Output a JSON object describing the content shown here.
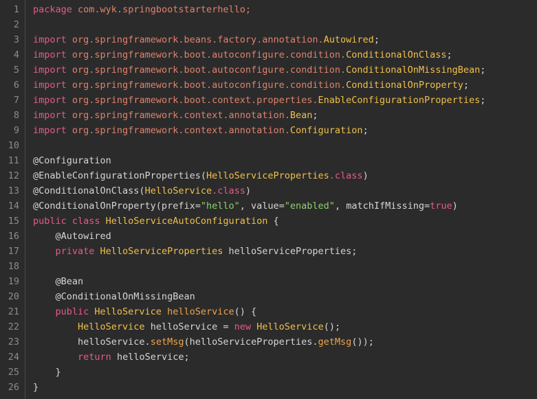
{
  "editor": {
    "lines": [
      [
        {
          "t": "package",
          "c": "kw"
        },
        {
          "t": " com.",
          "c": "pk"
        },
        {
          "t": "wyk.",
          "c": "pk"
        },
        {
          "t": "springbootstarterhello;",
          "c": "pk"
        }
      ],
      [],
      [
        {
          "t": "import",
          "c": "kw"
        },
        {
          "t": " org.springframework.beans.factory.annotation.",
          "c": "pk"
        },
        {
          "t": "Autowired",
          "c": "ty"
        },
        {
          "t": ";",
          "c": "pl"
        }
      ],
      [
        {
          "t": "import",
          "c": "kw"
        },
        {
          "t": " org.springframework.boot.autoconfigure.condition.",
          "c": "pk"
        },
        {
          "t": "ConditionalOnClass",
          "c": "ty"
        },
        {
          "t": ";",
          "c": "pl"
        }
      ],
      [
        {
          "t": "import",
          "c": "kw"
        },
        {
          "t": " org.springframework.boot.autoconfigure.condition.",
          "c": "pk"
        },
        {
          "t": "ConditionalOnMissingBean",
          "c": "ty"
        },
        {
          "t": ";",
          "c": "pl"
        }
      ],
      [
        {
          "t": "import",
          "c": "kw"
        },
        {
          "t": " org.springframework.boot.autoconfigure.condition.",
          "c": "pk"
        },
        {
          "t": "ConditionalOnProperty",
          "c": "ty"
        },
        {
          "t": ";",
          "c": "pl"
        }
      ],
      [
        {
          "t": "import",
          "c": "kw"
        },
        {
          "t": " org.springframework.boot.context.properties.",
          "c": "pk"
        },
        {
          "t": "EnableConfigurationProperties",
          "c": "ty"
        },
        {
          "t": ";",
          "c": "pl"
        }
      ],
      [
        {
          "t": "import",
          "c": "kw"
        },
        {
          "t": " org.springframework.context.annotation.",
          "c": "pk"
        },
        {
          "t": "Bean",
          "c": "ty"
        },
        {
          "t": ";",
          "c": "pl"
        }
      ],
      [
        {
          "t": "import",
          "c": "kw"
        },
        {
          "t": " org.springframework.context.annotation.",
          "c": "pk"
        },
        {
          "t": "Configuration",
          "c": "ty"
        },
        {
          "t": ";",
          "c": "pl"
        }
      ],
      [],
      [
        {
          "t": "@Configuration",
          "c": "an"
        }
      ],
      [
        {
          "t": "@EnableConfigurationProperties(",
          "c": "an"
        },
        {
          "t": "HelloServiceProperties",
          "c": "ty"
        },
        {
          "t": ".class",
          "c": "kw"
        },
        {
          "t": ")",
          "c": "pl"
        }
      ],
      [
        {
          "t": "@ConditionalOnClass(",
          "c": "an"
        },
        {
          "t": "HelloService",
          "c": "ty"
        },
        {
          "t": ".class",
          "c": "kw"
        },
        {
          "t": ")",
          "c": "pl"
        }
      ],
      [
        {
          "t": "@ConditionalOnProperty(prefix=",
          "c": "an"
        },
        {
          "t": "\"hello\"",
          "c": "st"
        },
        {
          "t": ", value=",
          "c": "pl"
        },
        {
          "t": "\"enabled\"",
          "c": "st"
        },
        {
          "t": ", matchIfMissing=",
          "c": "pl"
        },
        {
          "t": "true",
          "c": "kw"
        },
        {
          "t": ")",
          "c": "pl"
        }
      ],
      [
        {
          "t": "public class ",
          "c": "kw"
        },
        {
          "t": "HelloServiceAutoConfiguration",
          "c": "ty"
        },
        {
          "t": " {",
          "c": "pl"
        }
      ],
      [
        {
          "t": "    @Autowired",
          "c": "an"
        }
      ],
      [
        {
          "t": "    private ",
          "c": "kw"
        },
        {
          "t": "HelloServiceProperties",
          "c": "ty"
        },
        {
          "t": " helloServiceProperties;",
          "c": "pl"
        }
      ],
      [],
      [
        {
          "t": "    @Bean",
          "c": "an"
        }
      ],
      [
        {
          "t": "    @ConditionalOnMissingBean",
          "c": "an"
        }
      ],
      [
        {
          "t": "    public ",
          "c": "kw"
        },
        {
          "t": "HelloService",
          "c": "ty"
        },
        {
          "t": " ",
          "c": "pl"
        },
        {
          "t": "helloService",
          "c": "mt"
        },
        {
          "t": "() {",
          "c": "pl"
        }
      ],
      [
        {
          "t": "        ",
          "c": "pl"
        },
        {
          "t": "HelloService",
          "c": "ty"
        },
        {
          "t": " helloService = ",
          "c": "pl"
        },
        {
          "t": "new ",
          "c": "kw"
        },
        {
          "t": "HelloService",
          "c": "ty"
        },
        {
          "t": "();",
          "c": "pl"
        }
      ],
      [
        {
          "t": "        helloService.",
          "c": "pl"
        },
        {
          "t": "setMsg",
          "c": "mt"
        },
        {
          "t": "(helloServiceProperties.",
          "c": "pl"
        },
        {
          "t": "getMsg",
          "c": "mt"
        },
        {
          "t": "());",
          "c": "pl"
        }
      ],
      [
        {
          "t": "        ",
          "c": "pl"
        },
        {
          "t": "return",
          "c": "kw"
        },
        {
          "t": " helloService;",
          "c": "pl"
        }
      ],
      [
        {
          "t": "    }",
          "c": "pl"
        }
      ],
      [
        {
          "t": "}",
          "c": "pl"
        }
      ]
    ],
    "line_numbers": [
      "1",
      "2",
      "3",
      "4",
      "5",
      "6",
      "7",
      "8",
      "9",
      "10",
      "11",
      "12",
      "13",
      "14",
      "15",
      "16",
      "17",
      "18",
      "19",
      "20",
      "21",
      "22",
      "23",
      "24",
      "25",
      "26"
    ],
    "colors": {
      "background": "#2b2b2b",
      "keyword": "#e65a8a",
      "package": "#e0826c",
      "type": "#f0c04a",
      "string": "#8fd16e",
      "method": "#f0a44a",
      "plain": "#d6d6d6",
      "line_number": "#8c8c8c"
    }
  }
}
